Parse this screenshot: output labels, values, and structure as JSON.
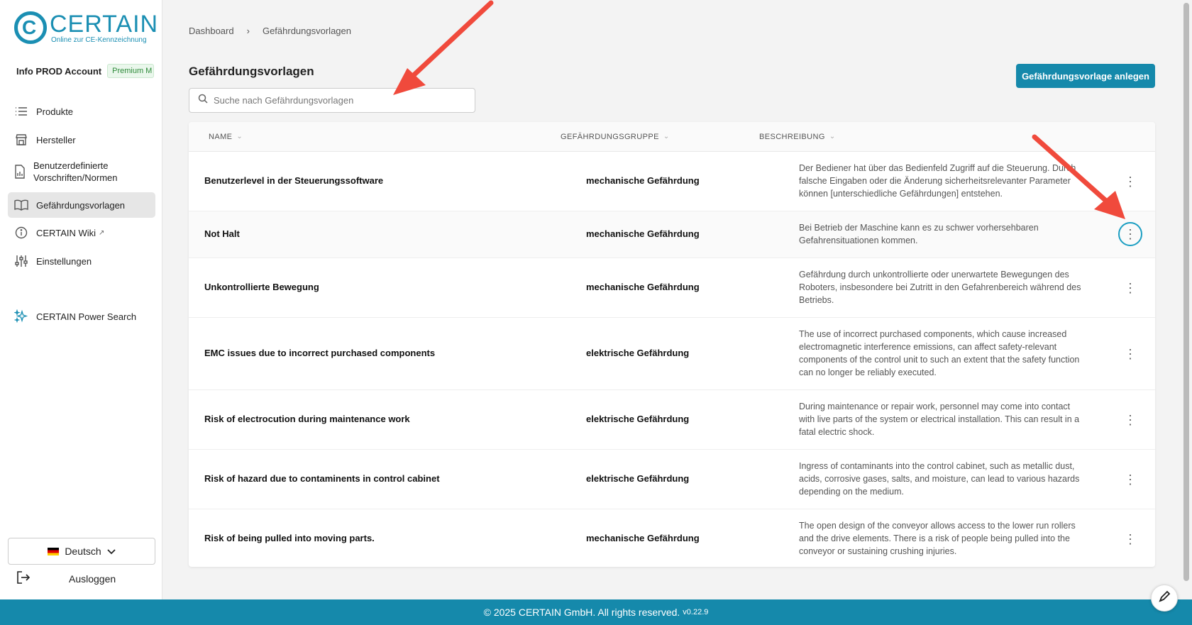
{
  "brand": {
    "name": "CERTAIN",
    "tagline": "Online zur CE-Kennzeichnung"
  },
  "account": {
    "name": "Info PROD Account",
    "badge": "Premium M"
  },
  "sidebar": {
    "items": [
      {
        "label": "Produkte",
        "icon": "list-icon"
      },
      {
        "label": "Hersteller",
        "icon": "store-icon"
      },
      {
        "label": "Benutzerdefinierte Vorschriften/Normen",
        "icon": "document-icon"
      },
      {
        "label": "Gefährdungsvorlagen",
        "icon": "book-icon",
        "active": true
      },
      {
        "label": "CERTAIN Wiki",
        "icon": "info-icon",
        "external": true
      },
      {
        "label": "Einstellungen",
        "icon": "sliders-icon"
      },
      {
        "label": "CERTAIN Power Search",
        "icon": "sparkle-icon"
      }
    ],
    "language": "Deutsch",
    "logout": "Ausloggen"
  },
  "breadcrumb": [
    "Dashboard",
    "Gefährdungsvorlagen"
  ],
  "page": {
    "title": "Gefährdungsvorlagen",
    "search_placeholder": "Suche nach Gefährdungsvorlagen",
    "create_button": "Gefährdungsvorlage anlegen"
  },
  "table": {
    "columns": [
      "NAME",
      "GEFÄHRDUNGSGRUPPE",
      "BESCHREIBUNG"
    ],
    "rows": [
      {
        "name": "Benutzerlevel in der Steuerungssoftware",
        "group": "mechanische Gefährdung",
        "description": "Der Bediener hat über das Bedienfeld Zugriff auf die Steuerung. Durch falsche Eingaben oder die Änderung sicherheitsrelevanter Parameter können [unterschiedliche Gefährdungen] entstehen."
      },
      {
        "name": "Not Halt",
        "group": "mechanische Gefährdung",
        "description": "Bei Betrieb der Maschine kann es zu schwer vorhersehbaren Gefahrensituationen kommen."
      },
      {
        "name": "Unkontrollierte Bewegung",
        "group": "mechanische Gefährdung",
        "description": "Gefährdung durch unkontrollierte oder unerwartete Bewegungen des Roboters, insbesondere bei Zutritt in den Gefahrenbereich während des Betriebs."
      },
      {
        "name": "EMC issues due to incorrect purchased components",
        "group": "elektrische Gefährdung",
        "description": "The use of incorrect purchased components, which cause increased electromagnetic interference emissions, can affect safety-relevant components of the control unit to such an extent that the safety function can no longer be reliably executed."
      },
      {
        "name": "Risk of electrocution during maintenance work",
        "group": "elektrische Gefährdung",
        "description": "During maintenance or repair work, personnel may come into contact with live parts of the system or electrical installation. This can result in a fatal electric shock."
      },
      {
        "name": "Risk of hazard due to contaminents in control cabinet",
        "group": "elektrische Gefährdung",
        "description": "Ingress of contaminants into the control cabinet, such as metallic dust, acids, corrosive gases, salts, and moisture, can lead to various hazards depending on the medium."
      },
      {
        "name": "Risk of being pulled into moving parts.",
        "group": "mechanische Gefährdung",
        "description": "The open design of the conveyor allows access to the lower run rollers and the drive elements. There is a risk of people being pulled into the conveyor or sustaining crushing injuries."
      }
    ]
  },
  "footer": {
    "copyright": "© 2025 CERTAIN GmbH. All rights reserved.",
    "version": "v0.22.9"
  },
  "colors": {
    "accent": "#1589ab",
    "annotation_arrow": "#f04a3c"
  }
}
